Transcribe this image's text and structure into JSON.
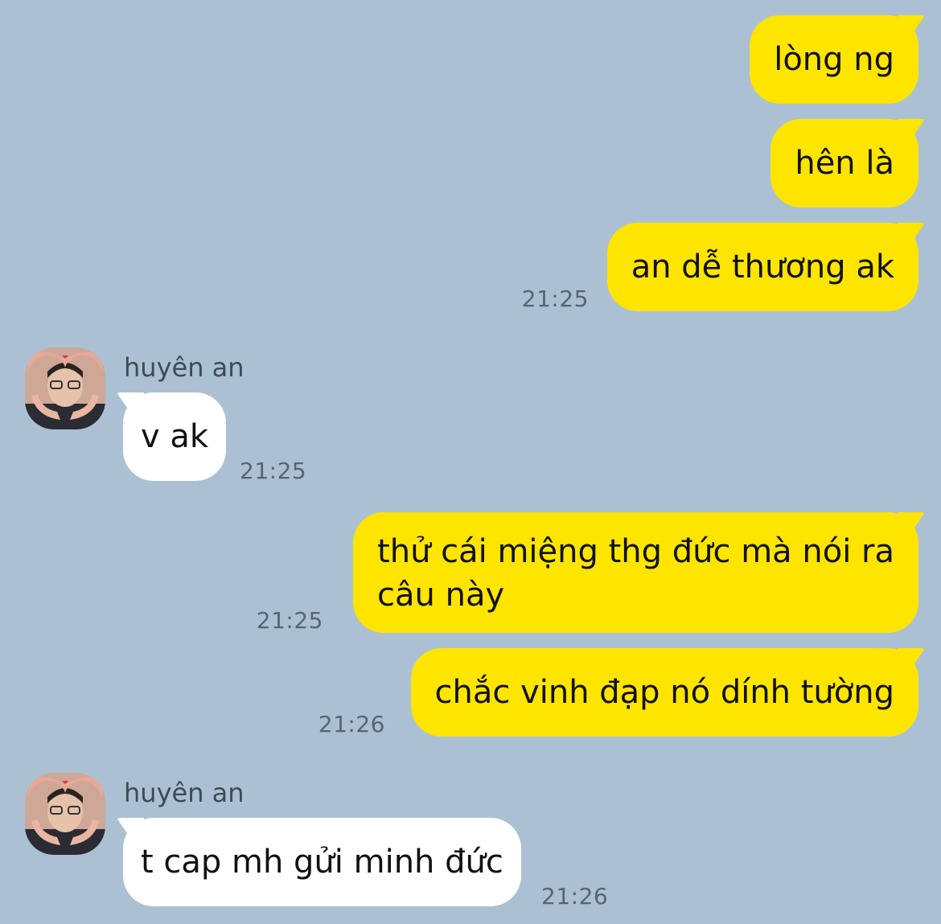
{
  "chat": {
    "colors": {
      "background": "#abc1d3",
      "outgoing_bubble": "#fee500",
      "incoming_bubble": "#ffffff",
      "timestamp": "#586470"
    },
    "messages": [
      {
        "id": "m1",
        "direction": "outgoing",
        "text": "lòng ng"
      },
      {
        "id": "m2",
        "direction": "outgoing",
        "text": "hên là"
      },
      {
        "id": "m3",
        "direction": "outgoing",
        "text": "an dễ thương ak",
        "time": "21:25"
      },
      {
        "id": "m4",
        "direction": "incoming",
        "sender": "huyên an",
        "avatar_icon": "avatar-heart-hands-photo",
        "text": "v ak",
        "time": "21:25"
      },
      {
        "id": "m5",
        "direction": "outgoing",
        "lines": [
          "thử cái miệng thg đức mà nói ra",
          "câu này"
        ],
        "time": "21:25"
      },
      {
        "id": "m6",
        "direction": "outgoing",
        "text": "chắc vinh đạp nó dính tường",
        "time": "21:26"
      },
      {
        "id": "m7",
        "direction": "incoming",
        "sender": "huyên an",
        "avatar_icon": "avatar-heart-hands-photo",
        "text": "t cap mh gửi minh đức",
        "time": "21:26"
      }
    ]
  }
}
